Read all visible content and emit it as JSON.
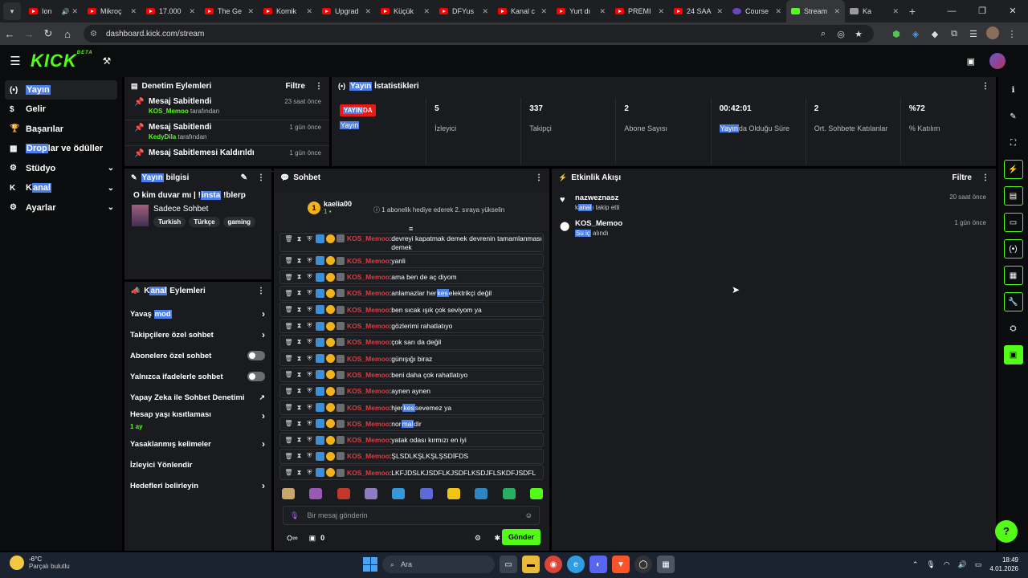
{
  "browser": {
    "tabs": [
      {
        "label": "Ion",
        "type": "yt",
        "speaker": true
      },
      {
        "label": "Mikroç",
        "type": "yt"
      },
      {
        "label": "17.000",
        "type": "yt"
      },
      {
        "label": "The Ge",
        "type": "yt"
      },
      {
        "label": "Komik",
        "type": "yt"
      },
      {
        "label": "Upgrad",
        "type": "yt"
      },
      {
        "label": "Küçük",
        "type": "yt"
      },
      {
        "label": "DFYus",
        "type": "yt"
      },
      {
        "label": "Kanal c",
        "type": "yt"
      },
      {
        "label": "Yurt dı",
        "type": "yt"
      },
      {
        "label": "PREMI",
        "type": "yt"
      },
      {
        "label": "24 SAA",
        "type": "yt"
      },
      {
        "label": "Course",
        "type": "course"
      },
      {
        "label": "Stream",
        "type": "kick",
        "active": true
      },
      {
        "label": "Ka",
        "type": "gen"
      }
    ],
    "url": "dashboard.kick.com/stream"
  },
  "header": {
    "logo": "KICK",
    "logo_badge": "BETA"
  },
  "sidebar": {
    "items": [
      {
        "icon": "(•)",
        "label_hl": "Yayın",
        "label": "",
        "active": true
      },
      {
        "icon": "$",
        "label": "Gelir"
      },
      {
        "icon": "🏆",
        "label": "Başarılar"
      },
      {
        "icon": "▦",
        "label_hl": "Drop",
        "label": "lar ve ödüller"
      },
      {
        "icon": "⚙",
        "label": "Stüdyo",
        "chevron": true
      },
      {
        "icon": "K",
        "label_pre": "K",
        "label_hl": "anal",
        "label": "",
        "chevron": true
      },
      {
        "icon": "⚙",
        "label": "Ayarlar",
        "chevron": true
      }
    ]
  },
  "moderation": {
    "title": "Denetim Eylemleri",
    "filter": "Filtre",
    "rows": [
      {
        "title": "Mesaj Sabitlendi",
        "user": "KOS_Memoo",
        "suffix": "tarafından",
        "time": "23 saat önce"
      },
      {
        "title": "Mesaj Sabitlendi",
        "user": "KedyDila",
        "suffix": "tarafından",
        "time": "1 gün önce"
      },
      {
        "title": "Mesaj Sabitlemesi Kaldırıldı",
        "user": "",
        "suffix": "",
        "time": "1 gün önce"
      }
    ]
  },
  "stats": {
    "title_hl": "Yayın",
    "title": " İstatistikleri",
    "live_hl": "YAYIN",
    "live_rest": "DA",
    "live_label": "Yayın",
    "items": [
      {
        "value": "5",
        "label": "İzleyici"
      },
      {
        "value": "337",
        "label": "Takipçi"
      },
      {
        "value": "2",
        "label": "Abone Sayısı"
      },
      {
        "value": "00:42:01",
        "label_hl": "Yayın",
        "label": "da Olduğu Süre"
      },
      {
        "value": "2",
        "label": "Ort. Sohbete Katılanlar"
      },
      {
        "value": "%72",
        "label": "% Katılım"
      }
    ]
  },
  "stream_info": {
    "title_hl": "Yayın",
    "title": " bilgisi",
    "stream_title_a": "O kim duvar mı | !",
    "stream_title_hl": "insta",
    "stream_title_b": " !blerp",
    "category": "Sadece Sohbet",
    "tags": [
      "Turkish",
      "Türkçe",
      "gaming"
    ]
  },
  "channel_actions": {
    "title_pre": "K",
    "title_hl": "anal",
    "title": " Eylemleri",
    "rows": [
      {
        "label_a": "Yavaş ",
        "label_hl": "mod",
        "control": "arrow"
      },
      {
        "label_a": "Takipçilere özel sohbet",
        "control": "arrow"
      },
      {
        "label_a": "Abonelere özel sohbet",
        "control": "toggle"
      },
      {
        "label_a": "Yalnızca ifadelerle sohbet",
        "control": "toggle"
      },
      {
        "label_a": "Yapay Zeka ile Sohbet Denetimi",
        "control": "ext"
      },
      {
        "label_a": "Hesap yaşı kısıtlaması",
        "sub": "1 ay",
        "control": "arrow"
      },
      {
        "label_a": "Yasaklanmış kelimeler",
        "control": "arrow"
      },
      {
        "label_a": "İzleyici Yönlendir",
        "control": "none"
      },
      {
        "label_a": "Hedefleri belirleyin",
        "control": "arrow"
      }
    ]
  },
  "chat": {
    "title": "Sohbet",
    "pinned_user": "kaelia00",
    "pinned_rank": "1",
    "pinned_count": "1",
    "pinned_message": "1 abonelik hediye ederek 2. sıraya yükselin",
    "messages": [
      {
        "user": "KOS_Memoo",
        "text": "devreyi kapatmak demek devrenin tamamlanması demek",
        "tall": true
      },
      {
        "user": "KOS_Memoo",
        "text": "yanli"
      },
      {
        "user": "KOS_Memoo",
        "text": "ama ben de aç diyom"
      },
      {
        "user": "KOS_Memoo",
        "text_a": "anlamazlar her",
        "text_hl": "kes",
        "text_b": " elektrikçi değil"
      },
      {
        "user": "KOS_Memoo",
        "text": "ben sıcak ışık çok seviyom ya"
      },
      {
        "user": "KOS_Memoo",
        "text": "gözlerimi rahatlatıyo"
      },
      {
        "user": "KOS_Memoo",
        "text": "çok sarı da değil"
      },
      {
        "user": "KOS_Memoo",
        "text": "günışığı biraz"
      },
      {
        "user": "KOS_Memoo",
        "text": "beni daha çok rahatlatıyo"
      },
      {
        "user": "KOS_Memoo",
        "text": "aynen aynen"
      },
      {
        "user": "KOS_Memoo",
        "text_a": "hjer",
        "text_hl": "kes",
        "text_b": " sevemez ya"
      },
      {
        "user": "KOS_Memoo",
        "text_a": "nor",
        "text_hl": "mal",
        "text_b": "dir"
      },
      {
        "user": "KOS_Memoo",
        "text": "yatak odası kırmızı en iyi"
      },
      {
        "user": "KOS_Memoo",
        "text": "ŞLSDLKŞLKŞLŞSDİFDS"
      },
      {
        "user": "KOS_Memoo",
        "text": "LKFJDSLKJSDFLKJSDFLKSDJFLSKDFJSDFL"
      }
    ],
    "emote_colors": [
      "#c9a66b",
      "#9b59b6",
      "#c0392b",
      "#8e7cc3",
      "#3498db",
      "#5d6bd8",
      "#f1c40f",
      "#2e86c1",
      "#27ae60",
      "#53fc18"
    ],
    "input_placeholder": "Bir mesaj gönderin",
    "points": "0",
    "send": "Gönder"
  },
  "activity": {
    "title": "Etkinlik Akışı",
    "filter": "Filtre",
    "rows": [
      {
        "icon": "♥",
        "name": "nazweznasz",
        "desc_a": "k",
        "desc_hl": "anal",
        "desc_b": "ı takip etti",
        "time": "20 saat önce"
      },
      {
        "icon": "⬤",
        "name": "KOS_Memoo",
        "desc_a": "",
        "desc_hl": "Su iç",
        "desc_b": " alındı",
        "time": "1 gün önce"
      }
    ]
  },
  "taskbar": {
    "temp": "-6°C",
    "weather": "Parçalı bulutlu",
    "search": "Ara",
    "time": "18:49",
    "date": "4.01.2026"
  },
  "colors": {
    "accent": "#53fc18",
    "highlight": "#4b7ee8",
    "live": "#e91916",
    "username": "#e6393f"
  }
}
